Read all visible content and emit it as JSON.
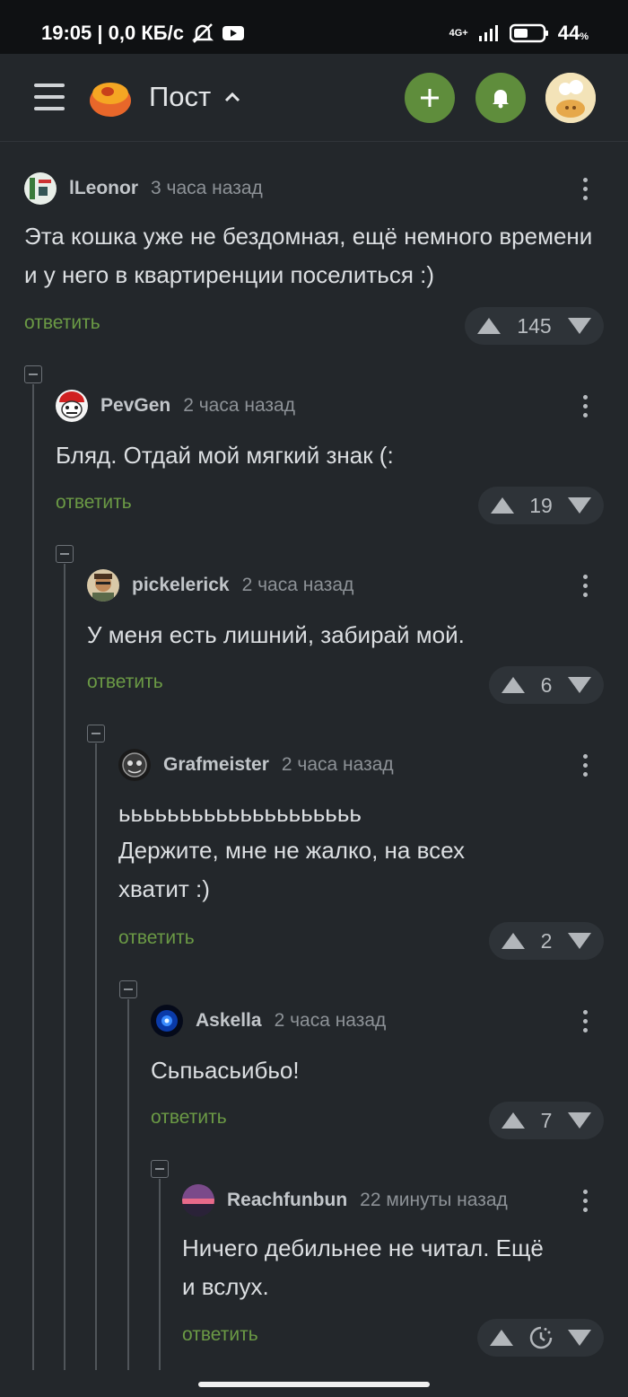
{
  "status_bar": {
    "time_speed": "19:05 | 0,0 КБ/с",
    "network": "4G+",
    "battery": "44",
    "battery_unit": "%"
  },
  "header": {
    "title": "Пост",
    "colors": {
      "accent": "#5f8d3c"
    }
  },
  "comments": [
    {
      "author": "lLeonor",
      "time": "3 часа назад",
      "text": "Эта кошка уже не бездомная, ещё немного времени и у него в квартиренции поселиться :)",
      "reply": "ответить",
      "rating": "145"
    },
    {
      "author": "PevGen",
      "time": "2 часа назад",
      "text": "Бляд. Отдай мой мягкий знак (:",
      "reply": "ответить",
      "rating": "19"
    },
    {
      "author": "pickelerick",
      "time": "2 часа назад",
      "text": "У меня есть лишний, забирай мой.",
      "reply": "ответить",
      "rating": "6"
    },
    {
      "author": "Grafmeister",
      "time": "2 часа назад",
      "text_line1": "ьььььььььььььььььььь",
      "text_line2": "Держите, мне не жалко, на всех",
      "text_line3": "хватит :)",
      "reply": "ответить",
      "rating": "2"
    },
    {
      "author": "Askella",
      "time": "2 часа назад",
      "text": "Сьпьасьибьо!",
      "reply": "ответить",
      "rating": "7"
    },
    {
      "author": "Reachfunbun",
      "time": "22 минуты назад",
      "text_line1": "Ничего дебильнее не читал. Ещё",
      "text_line2": "и вслух.",
      "reply": "ответить",
      "rating_icon": "pending-clock-icon"
    }
  ]
}
